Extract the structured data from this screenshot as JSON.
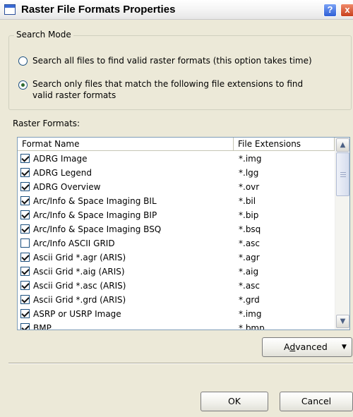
{
  "window": {
    "title": "Raster File Formats Properties",
    "help_label": "?",
    "close_label": "x"
  },
  "search_mode": {
    "legend": "Search Mode",
    "options": [
      {
        "label": "Search all files to find valid raster formats (this option takes time)",
        "selected": false
      },
      {
        "label_line1": "Search only files that match the following file extensions to find",
        "label_line2": "valid raster formats",
        "selected": true
      }
    ]
  },
  "formats_label": "Raster Formats:",
  "table": {
    "columns": [
      "Format Name",
      "File Extensions"
    ],
    "rows": [
      {
        "name": "ADRG Image",
        "ext": "*.img",
        "checked": true
      },
      {
        "name": "ADRG Legend",
        "ext": "*.lgg",
        "checked": true
      },
      {
        "name": "ADRG Overview",
        "ext": "*.ovr",
        "checked": true
      },
      {
        "name": "Arc/Info & Space Imaging BIL",
        "ext": "*.bil",
        "checked": true
      },
      {
        "name": "Arc/Info & Space Imaging BIP",
        "ext": "*.bip",
        "checked": true
      },
      {
        "name": "Arc/Info & Space Imaging BSQ",
        "ext": "*.bsq",
        "checked": true
      },
      {
        "name": "Arc/Info ASCII GRID",
        "ext": "*.asc",
        "checked": false
      },
      {
        "name": "Ascii Grid *.agr (ARIS)",
        "ext": "*.agr",
        "checked": true
      },
      {
        "name": "Ascii Grid *.aig (ARIS)",
        "ext": "*.aig",
        "checked": true
      },
      {
        "name": "Ascii Grid *.asc (ARIS)",
        "ext": "*.asc",
        "checked": true
      },
      {
        "name": "Ascii Grid *.grd (ARIS)",
        "ext": "*.grd",
        "checked": true
      },
      {
        "name": "ASRP or USRP Image",
        "ext": "*.img",
        "checked": true
      },
      {
        "name": "BMP",
        "ext": "*.bmp",
        "checked": true
      }
    ]
  },
  "buttons": {
    "advanced_pre": "A",
    "advanced_u": "d",
    "advanced_post": "vanced",
    "ok": "OK",
    "cancel": "Cancel"
  },
  "icons": {
    "scroll_up": "▲",
    "scroll_down": "▼",
    "dropdown": "▼"
  },
  "colors": {
    "list_border": "#7f9db9",
    "dialog_bg": "#ece9d8"
  }
}
